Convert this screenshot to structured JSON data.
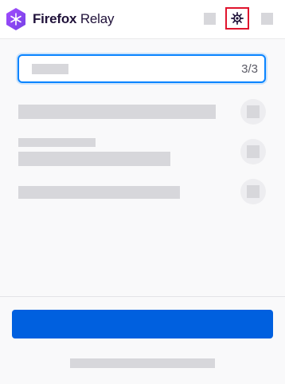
{
  "header": {
    "brand": "Firefox",
    "product": "Relay",
    "logo_icon": "firefox-relay-logo-icon",
    "settings_icon": "gear-icon",
    "accent_highlight_color": "#e0142d"
  },
  "search": {
    "count": "3/3",
    "border_color": "#0a84ff"
  },
  "colors": {
    "primary_button": "#0060df",
    "skeleton": "#d7d7db",
    "background": "#f9f9fa"
  }
}
